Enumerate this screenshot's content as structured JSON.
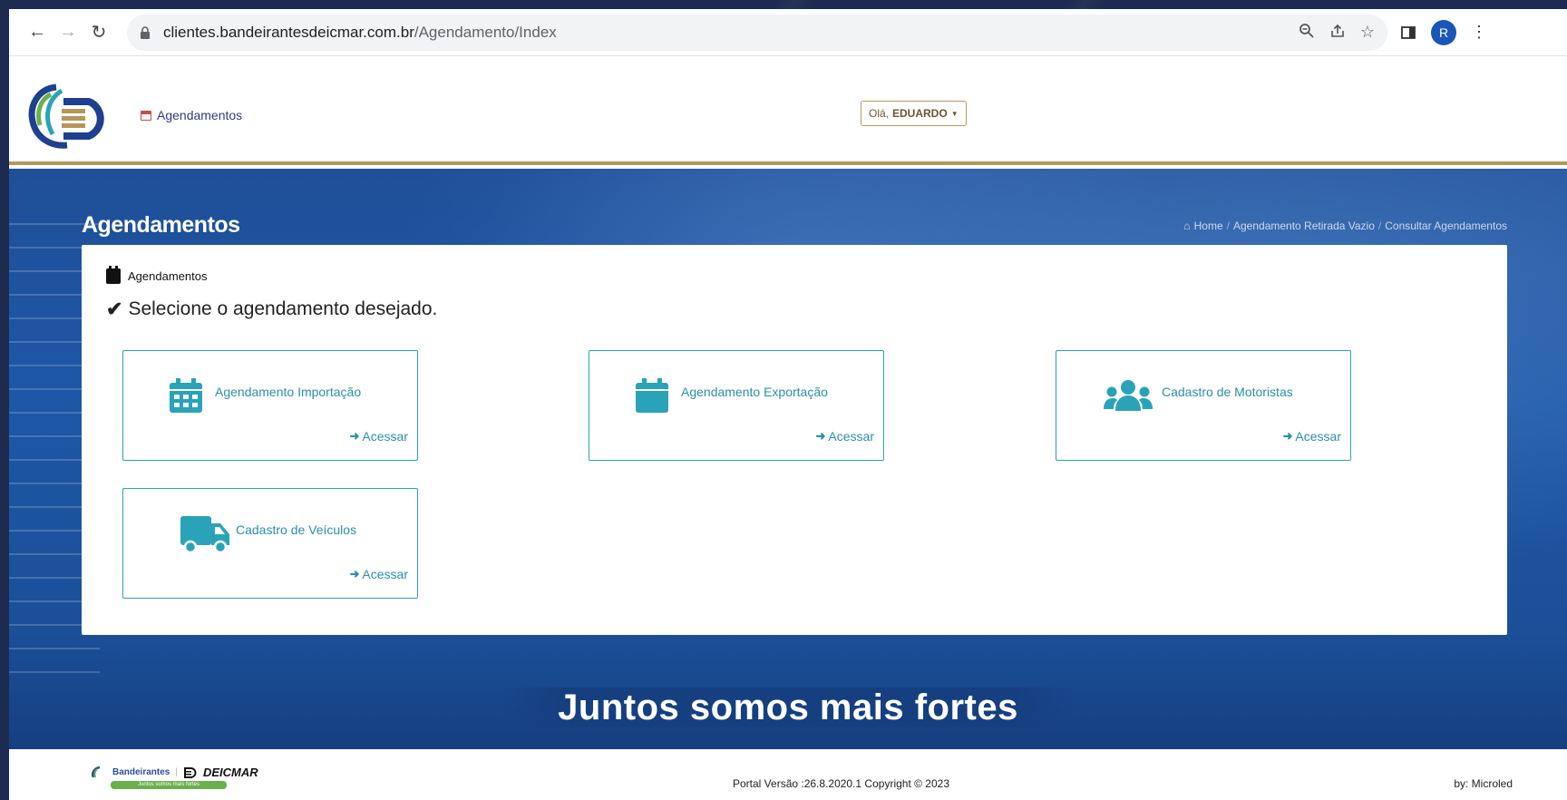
{
  "browser": {
    "url_host": "clientes.bandeirantesdeicmar.com.br",
    "url_path": "/Agendamento/Index",
    "avatar_letter": "R"
  },
  "header": {
    "nav_label": "Agendamentos",
    "greeting": "Olá,",
    "user_name": "EDUARDO"
  },
  "page": {
    "title": "Agendamentos",
    "breadcrumb": [
      "Home",
      "Agendamento Retirada Vazio",
      "Consultar Agendamentos"
    ]
  },
  "panel": {
    "heading": "Agendamentos",
    "instruction": "Selecione o agendamento desejado."
  },
  "cards": [
    {
      "title": "Agendamento Importação",
      "link": "Acessar",
      "icon": "calendar-grid-icon"
    },
    {
      "title": "Agendamento Exportação",
      "link": "Acessar",
      "icon": "calendar-icon"
    },
    {
      "title": "Cadastro de Motoristas",
      "link": "Acessar",
      "icon": "users-icon"
    },
    {
      "title": "Cadastro de Veículos",
      "link": "Acessar",
      "icon": "truck-icon"
    }
  ],
  "slogan": "Juntos somos mais fortes",
  "footer": {
    "brand_left": "Bandeirantes",
    "brand_right": "DEICMAR",
    "tagline": "Juntos somos mais fortes",
    "version": "Portal Versão :26.8.2020.1   Copyright © 2023",
    "by": "by: Microled"
  },
  "colors": {
    "accent": "#2aa3b8",
    "gold": "#b8965a",
    "hero": "#1d57a6"
  }
}
